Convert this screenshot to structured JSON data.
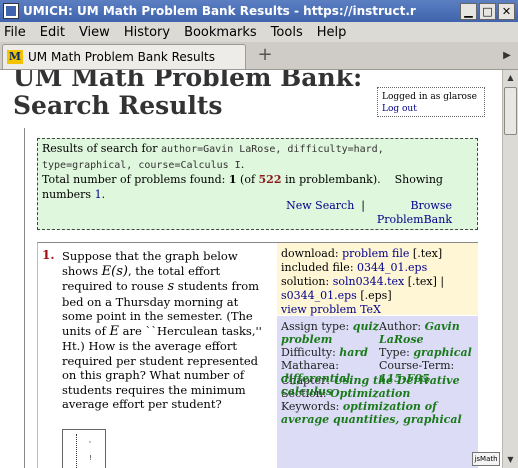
{
  "window": {
    "title": "UMICH: UM Math Problem Bank Results - https://instruct.r",
    "controls": [
      "▁",
      "□",
      "✕"
    ]
  },
  "menu": [
    "File",
    "Edit",
    "View",
    "History",
    "Bookmarks",
    "Tools",
    "Help"
  ],
  "tab": {
    "favicon_text": "M",
    "label": "UM Math Problem Bank Results",
    "new_tab_glyph": "+"
  },
  "page": {
    "title": "UM Math Problem Bank: Search Results",
    "login": {
      "text": "Logged in as glarose",
      "logout": "Log out"
    },
    "results": {
      "prefix": "Results of search for ",
      "query": "author=Gavin LaRose, difficulty=hard, type=graphical, course=Calculus I",
      "period": ".",
      "total_label": "Total number of problems found: ",
      "found": "1",
      "of_prefix": " (of ",
      "total_bank": "522",
      "of_suffix": " in problembank).",
      "showing_label": "Showing numbers ",
      "showing_value": "1",
      "showing_end": ".",
      "new_search": "New Search",
      "separator": "|",
      "browse": "Browse ProblemBank"
    },
    "problem": {
      "number": "1.",
      "text_1": "Suppose that the graph below shows ",
      "math_E_s": "E(s)",
      "text_2": ", the total effort required to rouse ",
      "math_s": "s",
      "text_3": " students from bed on a Thursday morning at some point in the semester. (The units of ",
      "math_E": "E",
      "text_4": " are ``Herculean tasks,'' Ht.) How is the average effort required per student represented on this graph? What number of students requires the minimum average effort per student?",
      "download_label": "download: ",
      "problem_file": "problem file",
      "tex_ext": " [.tex]",
      "included_label": "included file: ",
      "included_file": "0344_01.eps",
      "solution_label": "solution: ",
      "solution_file": "soln0344.tex",
      "solution_ext": " [.tex] |",
      "solution_eps": "s0344_01.eps",
      "eps_ext": " [.eps]",
      "view_tex": "view problem TeX",
      "assign_type_label": "Assign type: ",
      "assign_type": "quiz problem",
      "difficulty_label": "Difficulty: ",
      "difficulty": "hard",
      "matharea_label": "Matharea: ",
      "matharea": "differential calculus",
      "author_label": "Author: ",
      "author": "Gavin LaRose",
      "type_label": "Type: ",
      "type": "graphical",
      "course_term_label": "Course-Term: ",
      "course_term": "115-F05",
      "chapter_label": "Chapter: ",
      "chapter": "Using the Derivative",
      "section_label": "Section: ",
      "section": "Optimization",
      "keywords_label": "Keywords: ",
      "keywords": "optimization of average quantities, graphical"
    },
    "jsmath_button": "jsMath"
  }
}
